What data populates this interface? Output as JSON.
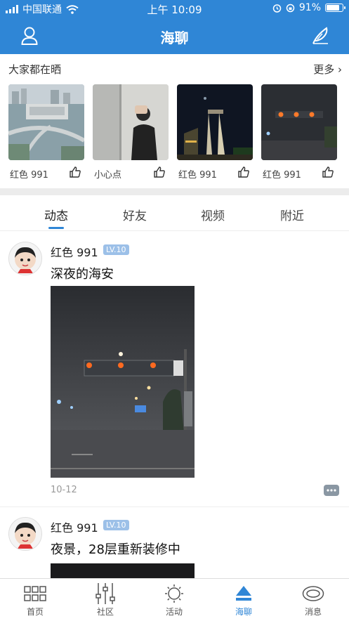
{
  "status_bar": {
    "carrier": "中国联通",
    "time": "上午 10:09",
    "battery": "91%",
    "battery_level": 0.91
  },
  "header": {
    "title": "海聊"
  },
  "share_section": {
    "title": "大家都在晒",
    "more_label": "更多",
    "items": [
      {
        "name": "红色 991"
      },
      {
        "name": "小心点"
      },
      {
        "name": "红色 991"
      },
      {
        "name": "红色 991"
      }
    ]
  },
  "tabs": [
    {
      "label": "动态"
    },
    {
      "label": "好友"
    },
    {
      "label": "视频"
    },
    {
      "label": "附近"
    }
  ],
  "posts": [
    {
      "username": "红色 991",
      "level": "LV.10",
      "text": "深夜的海安",
      "date": "10-12"
    },
    {
      "username": "红色 991",
      "level": "LV.10",
      "text": "夜景，28层重新装修中"
    }
  ],
  "bottom_nav": [
    {
      "label": "首页",
      "icon": "grid-icon"
    },
    {
      "label": "社区",
      "icon": "sliders-icon"
    },
    {
      "label": "活动",
      "icon": "sun-icon"
    },
    {
      "label": "海聊",
      "icon": "eject-icon"
    },
    {
      "label": "消息",
      "icon": "message-oval-icon"
    }
  ],
  "colors": {
    "accent": "#2f86d6",
    "level_badge": "#9cc0e8"
  }
}
